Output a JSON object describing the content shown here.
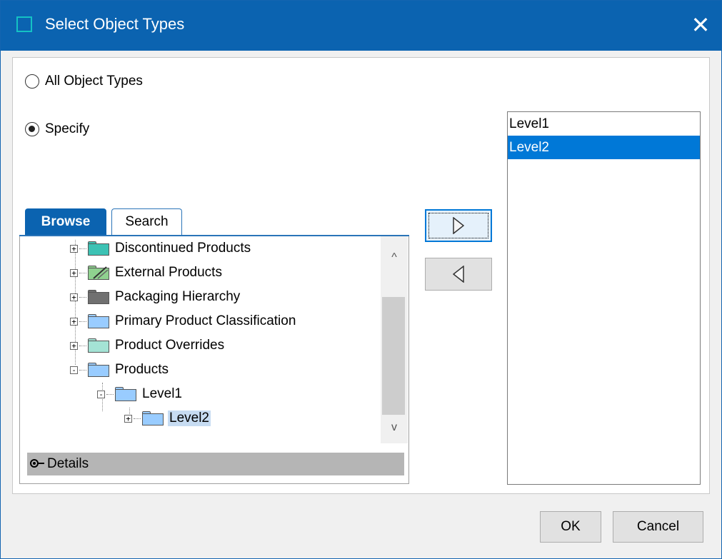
{
  "window": {
    "title": "Select Object Types",
    "close_glyph": "✕"
  },
  "options": {
    "all_label": "All Object Types",
    "specify_label": "Specify",
    "selected": "specify"
  },
  "tabs": [
    {
      "label": "Browse",
      "active": true
    },
    {
      "label": "Search",
      "active": false
    }
  ],
  "tree": {
    "nodes": [
      {
        "label": "Discontinued Products",
        "depth": 0,
        "expander": "+",
        "icon": "folder-teal-icon",
        "color": "#3cc2b4"
      },
      {
        "label": "External Products",
        "depth": 0,
        "expander": "+",
        "icon": "external-folder-icon",
        "color": "#8fd18f"
      },
      {
        "label": "Packaging Hierarchy",
        "depth": 0,
        "expander": "+",
        "icon": "folder-dark-icon",
        "color": "#707070"
      },
      {
        "label": "Primary Product Classification",
        "depth": 0,
        "expander": "+",
        "icon": "folder-blue-icon",
        "color": "#99ccff"
      },
      {
        "label": "Product Overrides",
        "depth": 0,
        "expander": "+",
        "icon": "folder-teal-icon",
        "color": "#a4e3d5"
      },
      {
        "label": "Products",
        "depth": 0,
        "expander": "-",
        "icon": "folder-blue-icon",
        "color": "#99ccff"
      },
      {
        "label": "Level1",
        "depth": 1,
        "expander": "-",
        "icon": "folder-blue-icon",
        "color": "#99ccff"
      },
      {
        "label": "Level2",
        "depth": 2,
        "expander": "+",
        "icon": "folder-blue-icon",
        "color": "#99ccff",
        "selected": true
      }
    ],
    "scroll_up_glyph": "^",
    "scroll_down_glyph": "v"
  },
  "details": {
    "label": "Details"
  },
  "selected_list": {
    "items": [
      {
        "label": "Level1",
        "selected": false
      },
      {
        "label": "Level2",
        "selected": true
      }
    ]
  },
  "buttons": {
    "ok": "OK",
    "cancel": "Cancel"
  },
  "colors": {
    "accent": "#0b63b0",
    "selection": "#0078d7",
    "tree_selection": "#c7dcf2"
  }
}
